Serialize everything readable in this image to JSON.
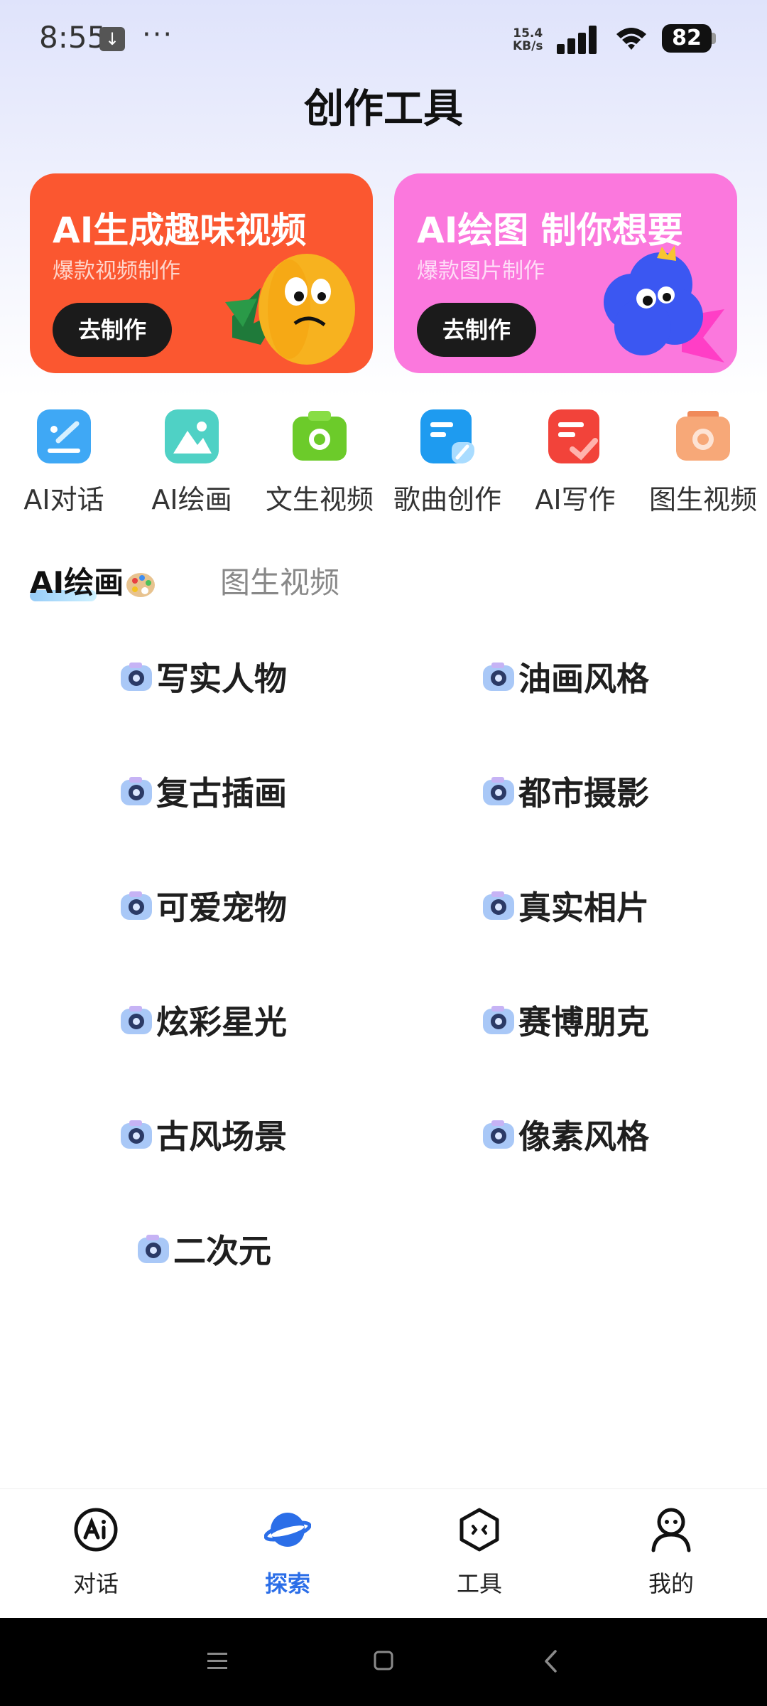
{
  "status_bar": {
    "time": "8:55",
    "download_indicator": "↓",
    "more_dots": "···",
    "net_speed_value": "15.4",
    "net_speed_unit": "KB/s",
    "battery": "82"
  },
  "page_title": "创作工具",
  "banners": [
    {
      "title": "AI生成趣味视频",
      "subtitle": "爆款视频制作",
      "button": "去制作",
      "color": "#fb5730"
    },
    {
      "title": "AI绘图 制你想要",
      "subtitle": "爆款图片制作",
      "button": "去制作",
      "color": "#fb78dd"
    }
  ],
  "tools": [
    {
      "label": "AI对话",
      "icon": "chat-pen-icon",
      "color": "#3fa8f5"
    },
    {
      "label": "AI绘画",
      "icon": "landscape-image-icon",
      "color": "#4fd1c5"
    },
    {
      "label": "文生视频",
      "icon": "camera-icon",
      "color": "#6ccb2a"
    },
    {
      "label": "歌曲创作",
      "icon": "note-edit-icon",
      "color": "#1e9bf0"
    },
    {
      "label": "AI写作",
      "icon": "document-check-icon",
      "color": "#f2433a"
    },
    {
      "label": "图生视频",
      "icon": "photo-camera-icon",
      "color": "#f7a878"
    }
  ],
  "tabs": {
    "active": "AI绘画",
    "inactive": "图生视频"
  },
  "styles": {
    "left": [
      "写实人物",
      "复古插画",
      "可爱宠物",
      "炫彩星光",
      "古风场景",
      "二次元"
    ],
    "right": [
      "油画风格",
      "都市摄影",
      "真实相片",
      "赛博朋克",
      "像素风格"
    ]
  },
  "bottom_nav": [
    {
      "label": "对话",
      "icon": "ai-chat-icon",
      "active": false
    },
    {
      "label": "探索",
      "icon": "planet-explore-icon",
      "active": true
    },
    {
      "label": "工具",
      "icon": "hexagon-tool-icon",
      "active": false
    },
    {
      "label": "我的",
      "icon": "profile-icon",
      "active": false
    }
  ],
  "colors": {
    "accent": "#2b6ee8",
    "nav_active": "#2b6ee8"
  }
}
